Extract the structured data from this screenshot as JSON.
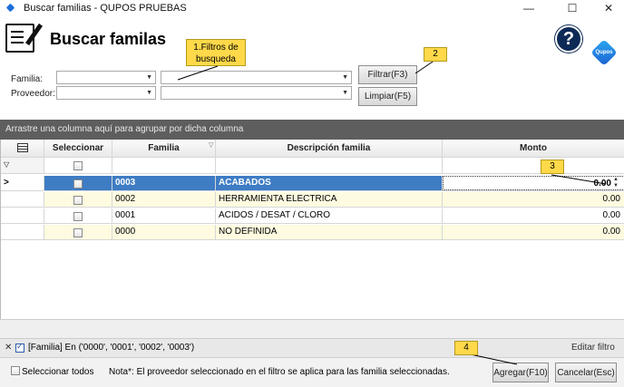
{
  "window": {
    "title": "Buscar familias - QUPOS PRUEBAS",
    "minimize": "—",
    "maximize": "☐",
    "close": "✕"
  },
  "header": {
    "title": "Buscar familas",
    "help": "?",
    "logo_text": "Qupos"
  },
  "filters": {
    "familia_label": "Familia:",
    "proveedor_label": "Proveedor:",
    "filtrar_button": "Filtrar(F3)",
    "limpiar_button": "Limpiar(F5)"
  },
  "group_panel_text": "Arrastre una columna aquí para agrupar por dicha columna",
  "grid": {
    "columns": [
      "Seleccionar",
      "Familia",
      "Descripción familia",
      "Monto"
    ],
    "rows": [
      {
        "familia": "0003",
        "descripcion": "ACABADOS",
        "monto": "0.00"
      },
      {
        "familia": "0002",
        "descripcion": "HERRAMIENTA ELECTRICA",
        "monto": "0.00"
      },
      {
        "familia": "0001",
        "descripcion": "ACIDOS / DESAT / CLORO",
        "monto": "0.00"
      },
      {
        "familia": "0000",
        "descripcion": "NO DEFINIDA",
        "monto": "0.00"
      }
    ]
  },
  "filter_bar": {
    "close": "✕",
    "filter_text": "[Familia] En ('0000', '0001', '0002', '0003')",
    "edit_filter": "Editar filtro"
  },
  "bottom": {
    "seleccionar_todos": "Seleccionar todos",
    "note": "Nota*: El proveedor seleccionado en el filtro se aplica para las familia seleccionadas.",
    "agregar_button": "Agregar(F10)",
    "cancelar_button": "Cancelar(Esc)"
  },
  "callouts": {
    "c1": "1.Filtros de busqueda",
    "c2": "2",
    "c3": "3",
    "c4": "4"
  },
  "colors": {
    "selected_row": "#3e7cc4",
    "alt_row": "#fffbe0",
    "callout": "#ffd94a",
    "group_panel": "#5e5e5e"
  }
}
